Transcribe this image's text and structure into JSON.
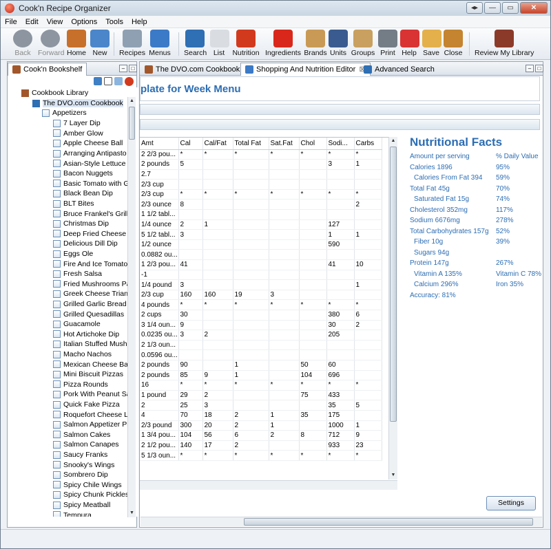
{
  "app": {
    "title": "Cook'n Recipe Organizer"
  },
  "window_buttons": [
    "◂▸",
    "—",
    "▭",
    "✕"
  ],
  "menu": [
    "File",
    "Edit",
    "View",
    "Options",
    "Tools",
    "Help"
  ],
  "toolbar": [
    {
      "label": "Back",
      "icon": "back-arrow-icon",
      "disabled": true
    },
    {
      "label": "Forward",
      "icon": "forward-arrow-icon",
      "disabled": true
    },
    {
      "label": "Home",
      "icon": "house-icon"
    },
    {
      "label": "New",
      "icon": "new-recipe-icon"
    },
    {
      "label": "Recipes",
      "icon": "recipe-card-icon"
    },
    {
      "label": "Menus",
      "icon": "menu-calendar-icon"
    },
    {
      "label": "Search",
      "icon": "magnifier-icon"
    },
    {
      "label": "List",
      "icon": "list-icon"
    },
    {
      "label": "Nutrition",
      "icon": "heart-icon"
    },
    {
      "label": "Ingredients",
      "icon": "apple-icon"
    },
    {
      "label": "Brands",
      "icon": "tag-icon"
    },
    {
      "label": "Units",
      "icon": "scale-icon"
    },
    {
      "label": "Groups",
      "icon": "clipboard-icon"
    },
    {
      "label": "Print",
      "icon": "printer-icon"
    },
    {
      "label": "Help",
      "icon": "lifebuoy-icon"
    },
    {
      "label": "Save",
      "icon": "folder-icon"
    },
    {
      "label": "Close",
      "icon": "door-icon"
    },
    {
      "label": "Review My Library",
      "icon": "books-icon"
    }
  ],
  "bookshelf": {
    "tab_label": "Cook'n Bookshelf",
    "library": "Cookbook Library",
    "cookbook": "The DVO.com Cookbook",
    "chapter": "Appetizers",
    "recipes": [
      "7 Layer Dip",
      "Amber Glow",
      "Apple Cheese Ball",
      "Arranging Antipasto",
      "Asian-Style Lettuce W",
      "Bacon Nuggets",
      "Basic Tomato with G",
      "Black Bean Dip",
      "BLT Bites",
      "Bruce Frankel's Grille",
      "Christmas Dip",
      "Deep Fried Cheese",
      "Delicious Dill Dip",
      "Eggs Ole",
      "Fire And Ice Tomatoe",
      "Fresh Salsa",
      "Fried Mushrooms Pa",
      "Greek Cheese Triangl",
      "Grilled Garlic Bread F",
      "Grilled Quesadillas",
      "Guacamole",
      "Hot Artichoke Dip",
      "Italian Stuffed Mushr",
      "Macho Nachos",
      "Mexican Cheese Ball",
      "Mini Biscuit Pizzas",
      "Pizza Rounds",
      "Pork With Peanut Sau",
      "Quick Fake Pizza",
      "Roquefort Cheese Lo",
      "Salmon Appetizer Pie",
      "Salmon Cakes",
      "Salmon Canapes",
      "Saucy Franks",
      "Snooky's Wings",
      "Sombrero Dip",
      "Spicy Chile Wings",
      "Spicy Chunk Pickles",
      "Spicy Meatball",
      "Tempura"
    ]
  },
  "tabs": [
    {
      "label": "The DVO.com Cookbook",
      "active": false
    },
    {
      "label": "Shopping And Nutrition Editor",
      "active": true,
      "closable": true
    },
    {
      "label": "Advanced Search",
      "active": false
    }
  ],
  "editor": {
    "heading": "plate for Week Menu",
    "columns": [
      "Amt",
      "Cal",
      "Cal/Fat",
      "Total Fat",
      "Sat.Fat",
      "Chol",
      "Sodi...",
      "Carbs"
    ],
    "rows": [
      [
        "2 2/3 pou...",
        "*",
        "*",
        "*",
        "*",
        "*",
        "*",
        "*"
      ],
      [
        "2 pounds",
        "5",
        "",
        "",
        "",
        "",
        "3",
        "1"
      ],
      [
        "2.7",
        "",
        "",
        "",
        "",
        "",
        "",
        ""
      ],
      [
        "2/3 cup",
        "",
        "",
        "",
        "",
        "",
        "",
        ""
      ],
      [
        "2/3 cup",
        "*",
        "*",
        "*",
        "*",
        "*",
        "*",
        "*"
      ],
      [
        "2/3 ounce",
        "8",
        "",
        "",
        "",
        "",
        "",
        "2"
      ],
      [
        "1 1/2 tabl...",
        "",
        "",
        "",
        "",
        "",
        "",
        ""
      ],
      [
        "1/4 ounce",
        "2",
        "1",
        "",
        "",
        "",
        "127",
        ""
      ],
      [
        "5 1/2 tabl...",
        "3",
        "",
        "",
        "",
        "",
        "1",
        "1"
      ],
      [
        "1/2 ounce",
        "",
        "",
        "",
        "",
        "",
        "590",
        ""
      ],
      [
        "0.0882 ou...",
        "",
        "",
        "",
        "",
        "",
        "",
        ""
      ],
      [
        "1 2/3 pou...",
        "41",
        "",
        "",
        "",
        "",
        "41",
        "10"
      ],
      [
        "-1",
        "",
        "",
        "",
        "",
        "",
        "",
        ""
      ],
      [
        "1/4 pound",
        "3",
        "",
        "",
        "",
        "",
        "",
        "1"
      ],
      [
        "2/3 cup",
        "160",
        "160",
        "19",
        "3",
        "",
        "",
        ""
      ],
      [
        "4 pounds",
        "*",
        "*",
        "*",
        "*",
        "*",
        "*",
        "*"
      ],
      [
        "2 cups",
        "30",
        "",
        "",
        "",
        "",
        "380",
        "6"
      ],
      [
        "3 1/4 oun...",
        "9",
        "",
        "",
        "",
        "",
        "30",
        "2"
      ],
      [
        "0.0235 ou...",
        "3",
        "2",
        "",
        "",
        "",
        "205",
        ""
      ],
      [
        "2 1/3 oun...",
        "",
        "",
        "",
        "",
        "",
        "",
        ""
      ],
      [
        "0.0596 ou...",
        "",
        "",
        "",
        "",
        "",
        "",
        ""
      ],
      [
        "2 pounds",
        "90",
        "",
        "1",
        "",
        "50",
        "60",
        ""
      ],
      [
        "2 pounds",
        "85",
        "9",
        "1",
        "",
        "104",
        "696",
        ""
      ],
      [
        "16",
        "*",
        "*",
        "*",
        "*",
        "*",
        "*",
        "*"
      ],
      [
        "1 pound",
        "29",
        "2",
        "",
        "",
        "75",
        "433",
        ""
      ],
      [
        "2",
        "25",
        "3",
        "",
        "",
        "",
        "35",
        "5"
      ],
      [
        "4",
        "70",
        "18",
        "2",
        "1",
        "35",
        "175",
        ""
      ],
      [
        "2/3 pound",
        "300",
        "20",
        "2",
        "1",
        "",
        "1000",
        "1"
      ],
      [
        "1 3/4 pou...",
        "104",
        "56",
        "6",
        "2",
        "8",
        "712",
        "9"
      ],
      [
        "2 1/2 pou...",
        "140",
        "17",
        "2",
        "",
        "",
        "933",
        "23"
      ],
      [
        "5 1/3 oun...",
        "*",
        "*",
        "*",
        "*",
        "*",
        "*",
        "*"
      ]
    ]
  },
  "nutrition": {
    "title": "Nutritional Facts",
    "rows": [
      {
        "l": "Amount per serving",
        "r": "% Daily Value",
        "indent": false
      },
      {
        "l": "Calories 1896",
        "r": "95%",
        "indent": false
      },
      {
        "l": "Calories From Fat 394",
        "r": "59%",
        "indent": true
      },
      {
        "l": "Total Fat 45g",
        "r": "70%",
        "indent": false
      },
      {
        "l": "Saturated Fat 15g",
        "r": "74%",
        "indent": true
      },
      {
        "l": "Cholesterol 352mg",
        "r": "117%",
        "indent": false
      },
      {
        "l": "Sodium 6676mg",
        "r": "278%",
        "indent": false
      },
      {
        "l": "Total Carbohydrates 157g",
        "r": "52%",
        "indent": false
      },
      {
        "l": "Fiber 10g",
        "r": "39%",
        "indent": true
      },
      {
        "l": "Sugars 94g",
        "r": "",
        "indent": true
      },
      {
        "l": "Protein 147g",
        "r": "267%",
        "indent": false
      },
      {
        "l": "Vitamin A 135%",
        "r": "Vitamin C 78%",
        "indent": true
      },
      {
        "l": "Calcium 296%",
        "r": "Iron 35%",
        "indent": true
      },
      {
        "l": "Accuracy: 81%",
        "r": "",
        "indent": false
      }
    ]
  },
  "settings_label": "Settings",
  "colors": {
    "accent": "#2c6db3"
  }
}
